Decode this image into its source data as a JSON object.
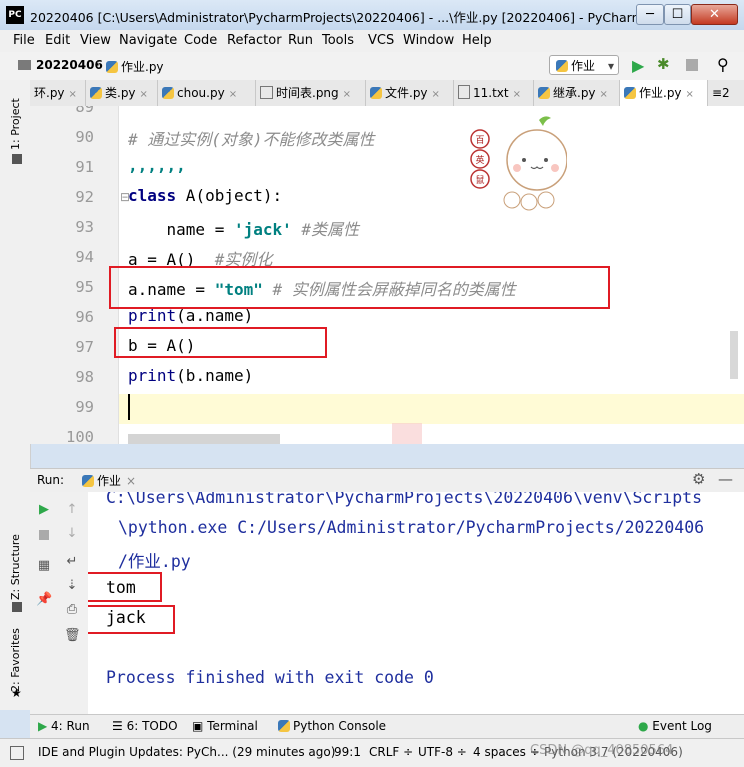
{
  "window": {
    "title": "20220406 [C:\\Users\\Administrator\\PycharmProjects\\20220406] - ...\\作业.py [20220406] - PyCharm (Adm...",
    "app_badge": "PC",
    "min_glyph": "─",
    "max_glyph": "☐",
    "close_glyph": "✕"
  },
  "menu": [
    "File",
    "Edit",
    "View",
    "Navigate",
    "Code",
    "Refactor",
    "Run",
    "Tools",
    "VCS",
    "Window",
    "Help"
  ],
  "nav": {
    "project": "20220406",
    "file": "作业.py",
    "run_config": "作业"
  },
  "tabs": [
    {
      "label": "环.py"
    },
    {
      "label": "类.py"
    },
    {
      "label": "chou.py"
    },
    {
      "label": "时间表.png"
    },
    {
      "label": "文件.py"
    },
    {
      "label": "11.txt"
    },
    {
      "label": "继承.py"
    },
    {
      "label": "作业.py"
    }
  ],
  "tabs_overflow": "≡2",
  "side_labels": {
    "project": "1: Project",
    "structure": "Z: Structure",
    "favorites": "2: Favorites"
  },
  "editor": {
    "line_numbers": [
      "89",
      "90",
      "91",
      "92",
      "93",
      "94",
      "95",
      "96",
      "97",
      "98",
      "99",
      "100"
    ],
    "lines": {
      "l89": "'''",
      "l90": "# 通过实例(对象)不能修改类属性",
      "l91": ",,,,,,",
      "l92_kw": "class",
      "l92_rest": " A(object):",
      "l93_pre": "    name = ",
      "l93_str": "'jack'",
      "l93_cm": " #类属性",
      "l94_code": "a = A()  ",
      "l94_cm": "#实例化",
      "l95_code": "a.name = ",
      "l95_str": "\"tom\"",
      "l95_cm": " # 实例属性会屏蔽掉同名的类属性",
      "l96_fn": "print",
      "l96_rest": "(a.name)",
      "l97": "b = A()",
      "l98_fn": "print",
      "l98_rest": "(b.name)"
    },
    "sticker_badges": [
      "百",
      "英",
      "鼠"
    ]
  },
  "run": {
    "label": "Run:",
    "tab": "作业",
    "console": [
      "C:\\Users\\Administrator\\PycharmProjects\\20220406\\venv\\Scripts",
      "\\python.exe C:/Users/Administrator/PycharmProjects/20220406",
      "/作业.py",
      "tom",
      "jack",
      "",
      "Process finished with exit code 0"
    ]
  },
  "bottom_tabs": [
    "4: Run",
    "6: TODO",
    "Terminal",
    "Python Console",
    "Event Log"
  ],
  "status": {
    "message": "IDE and Plugin Updates: PyCh... (29 minutes ago)",
    "position": "99:1",
    "line_sep": "CRLF ÷",
    "encoding": "UTF-8 ÷",
    "indent": "4 spaces ÷",
    "interpreter": "Python 3.7 (20220406)",
    "watermark": "CSDN @qq_40850564"
  },
  "colors": {
    "highlight_box": "#e01b24",
    "keyword": "#000080",
    "string": "#008080",
    "comment": "#8c8c8c",
    "console_path": "#1f2f9e",
    "current_line": "#fffbd6"
  }
}
